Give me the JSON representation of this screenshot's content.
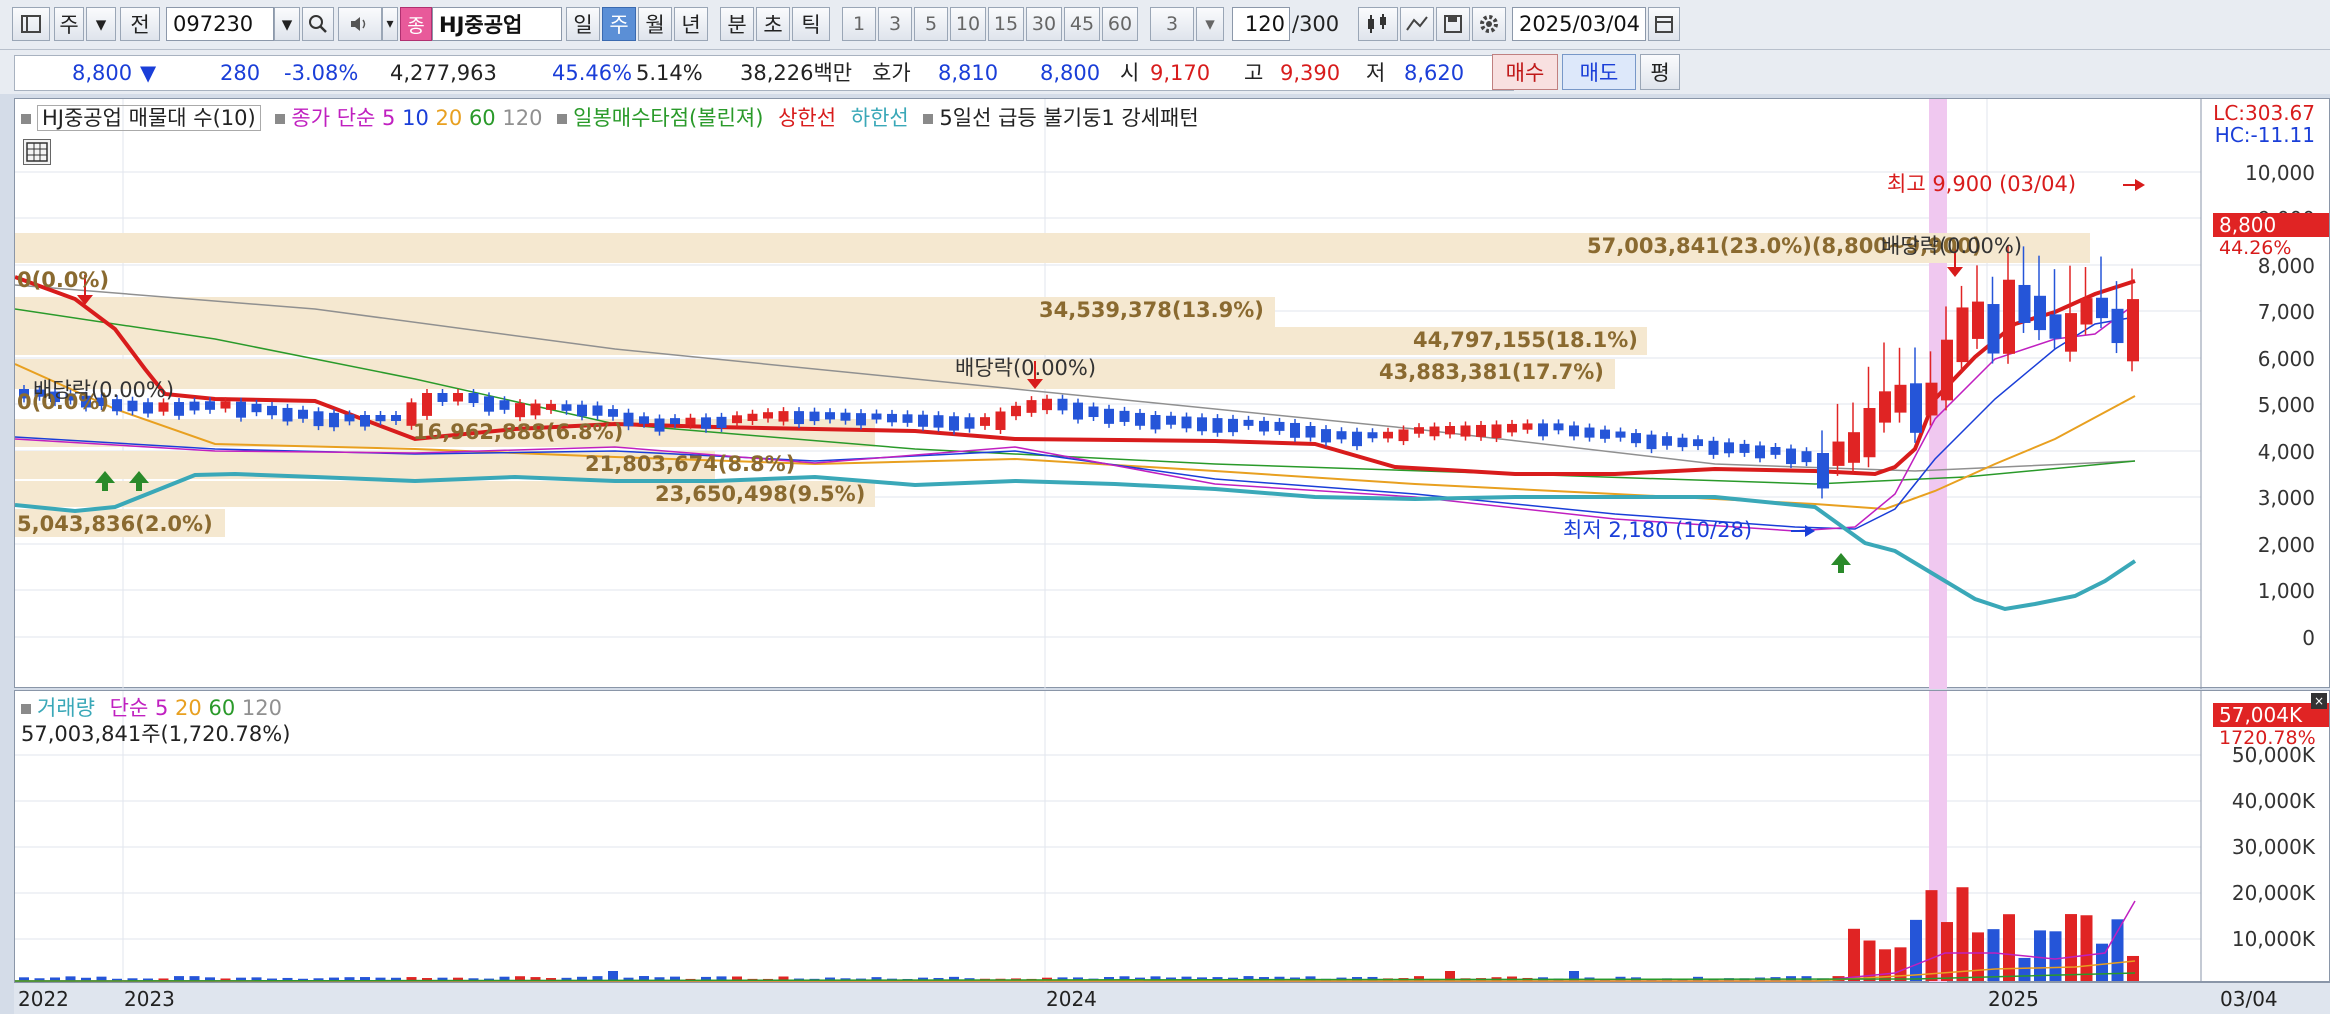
{
  "toolbar": {
    "mode": "주",
    "prev": "전",
    "code": "097230",
    "type_badge": "종",
    "name": "HJ중공업",
    "periods": [
      "일",
      "주",
      "월",
      "년"
    ],
    "active_period": "주",
    "sub_periods": [
      "분",
      "초",
      "틱"
    ],
    "intervals": [
      "1",
      "3",
      "5",
      "10",
      "15",
      "30",
      "45",
      "60"
    ],
    "interval_value": "3",
    "count_value": "120",
    "count_total": "/300",
    "date": "2025/03/04"
  },
  "quote": {
    "price": "8,800",
    "arrow": "▼",
    "change": "280",
    "change_pct": "-3.08%",
    "volume": "4,277,963",
    "vol_ratio": "45.46%",
    "turnover": "5.14%",
    "amount": "38,226백만",
    "ask_label": "호가",
    "ask1": "8,810",
    "ask2": "8,800",
    "open_label": "시",
    "open": "9,170",
    "high_label": "고",
    "high": "9,390",
    "low_label": "저",
    "low": "8,620",
    "buy_button": "매수",
    "sell_button": "매도",
    "eval_button": "평"
  },
  "legend_top": {
    "volume_profile": "HJ중공업 매물대 수(10)",
    "ma_label": "종가 단순",
    "ma5": "5",
    "ma10": "10",
    "ma20": "20",
    "ma60": "60",
    "ma120": "120",
    "bollinger": "일봉매수타점(볼린져)",
    "upper": "상한선",
    "lower": "하한선",
    "pattern": "5일선 급등 불기둥1 강세패턴"
  },
  "price_axis": {
    "labels": [
      "10,000",
      "9,000",
      "8,000",
      "7,000",
      "6,000",
      "5,000",
      "4,000",
      "3,000",
      "2,000",
      "1,000",
      "0"
    ],
    "lc": "LC:303.67",
    "hc": "HC:-11.11",
    "current_tag": "8,800",
    "current_pct": "44.26%"
  },
  "annotations": {
    "max": "최고 9,900 (03/04)",
    "min": "최저 2,180 (10/28)",
    "dividend1": "배당락(0.00%)",
    "dividend2": "배당락(0.00%)",
    "dividend3": "배당락(0.00%)",
    "zero1": "0(0.0%)",
    "zero2": "0(0.0%)"
  },
  "volume_profile_labels": [
    "57,003,841(23.0%)(8,800~9,900)",
    "34,539,378(13.9%)",
    "44,797,155(18.1%)",
    "43,883,381(17.7%)",
    "16,962,888(6.8%)",
    "21,803,674(8.8%)",
    "23,650,498(9.5%)",
    "5,043,836(2.0%)"
  ],
  "volume_legend": {
    "title": "거래량",
    "ma_label": "단순",
    "ma5": "5",
    "ma20": "20",
    "ma60": "60",
    "ma120": "120",
    "summary": "57,003,841주(1,720.78%)"
  },
  "volume_axis": {
    "labels": [
      "50,000K",
      "40,000K",
      "30,000K",
      "20,000K",
      "10,000K"
    ],
    "current_tag": "57,004K",
    "current_pct": "1720.78%"
  },
  "x_axis": [
    "2022",
    "2023",
    "2024",
    "2025",
    "03/04"
  ],
  "colors": {
    "up": "#e02424",
    "down": "#2555d8",
    "upper_band": "#d81c1c",
    "lower_band": "#3aa8b8",
    "ma5": "#c020c0",
    "ma10": "#1a3ed8",
    "ma20": "#e8a020",
    "ma60": "#2a9a2a",
    "ma120": "#808080",
    "profile": "#f5e8d0",
    "highlight": "#f0c8f0"
  }
}
